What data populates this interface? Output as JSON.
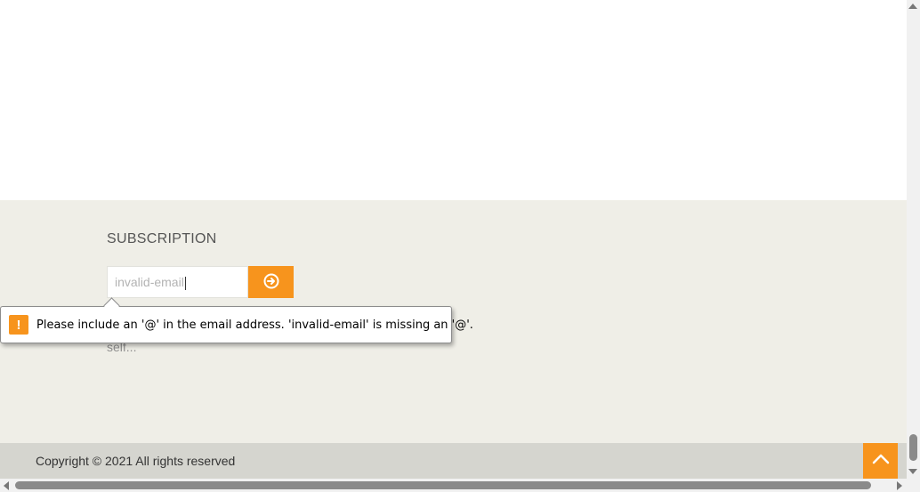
{
  "subscription": {
    "title": "SUBSCRIPTION",
    "email_value": "invalid-email",
    "submit_icon": "arrow-circle-right-icon",
    "description": "our site and be updated your self..."
  },
  "validation_tooltip": {
    "icon": "exclamation-icon",
    "message": "Please include an '@' in the email address. 'invalid-email' is missing an '@'."
  },
  "footer": {
    "copyright": "Copyright © 2021 All rights reserved",
    "back_to_top_icon": "chevron-up-icon"
  },
  "colors": {
    "accent": "#f7941d",
    "footer_bg": "#efeee7",
    "copyright_bar": "#d5d5cf"
  }
}
